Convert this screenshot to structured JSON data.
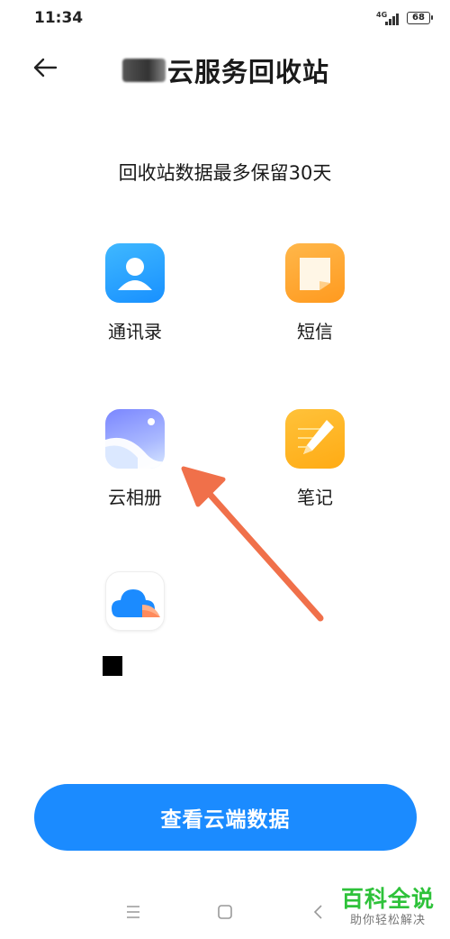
{
  "status_bar": {
    "time": "11:34",
    "network": "4G",
    "battery": "68"
  },
  "header": {
    "title": "云服务回收站"
  },
  "subtitle": "回收站数据最多保留30天",
  "apps": [
    {
      "label": "通讯录",
      "icon": "contacts-icon"
    },
    {
      "label": "短信",
      "icon": "sms-icon"
    },
    {
      "label": "云相册",
      "icon": "gallery-icon"
    },
    {
      "label": "笔记",
      "icon": "notes-icon"
    },
    {
      "label": "",
      "icon": "cloud-drive-icon"
    }
  ],
  "primary_button": {
    "label": "查看云端数据",
    "color": "#1b8bff"
  },
  "annotation": {
    "arrow_color": "#f0704a"
  },
  "watermark": {
    "main": "百科全说",
    "sub": "助你轻松解决",
    "color": "#2ec23a"
  }
}
